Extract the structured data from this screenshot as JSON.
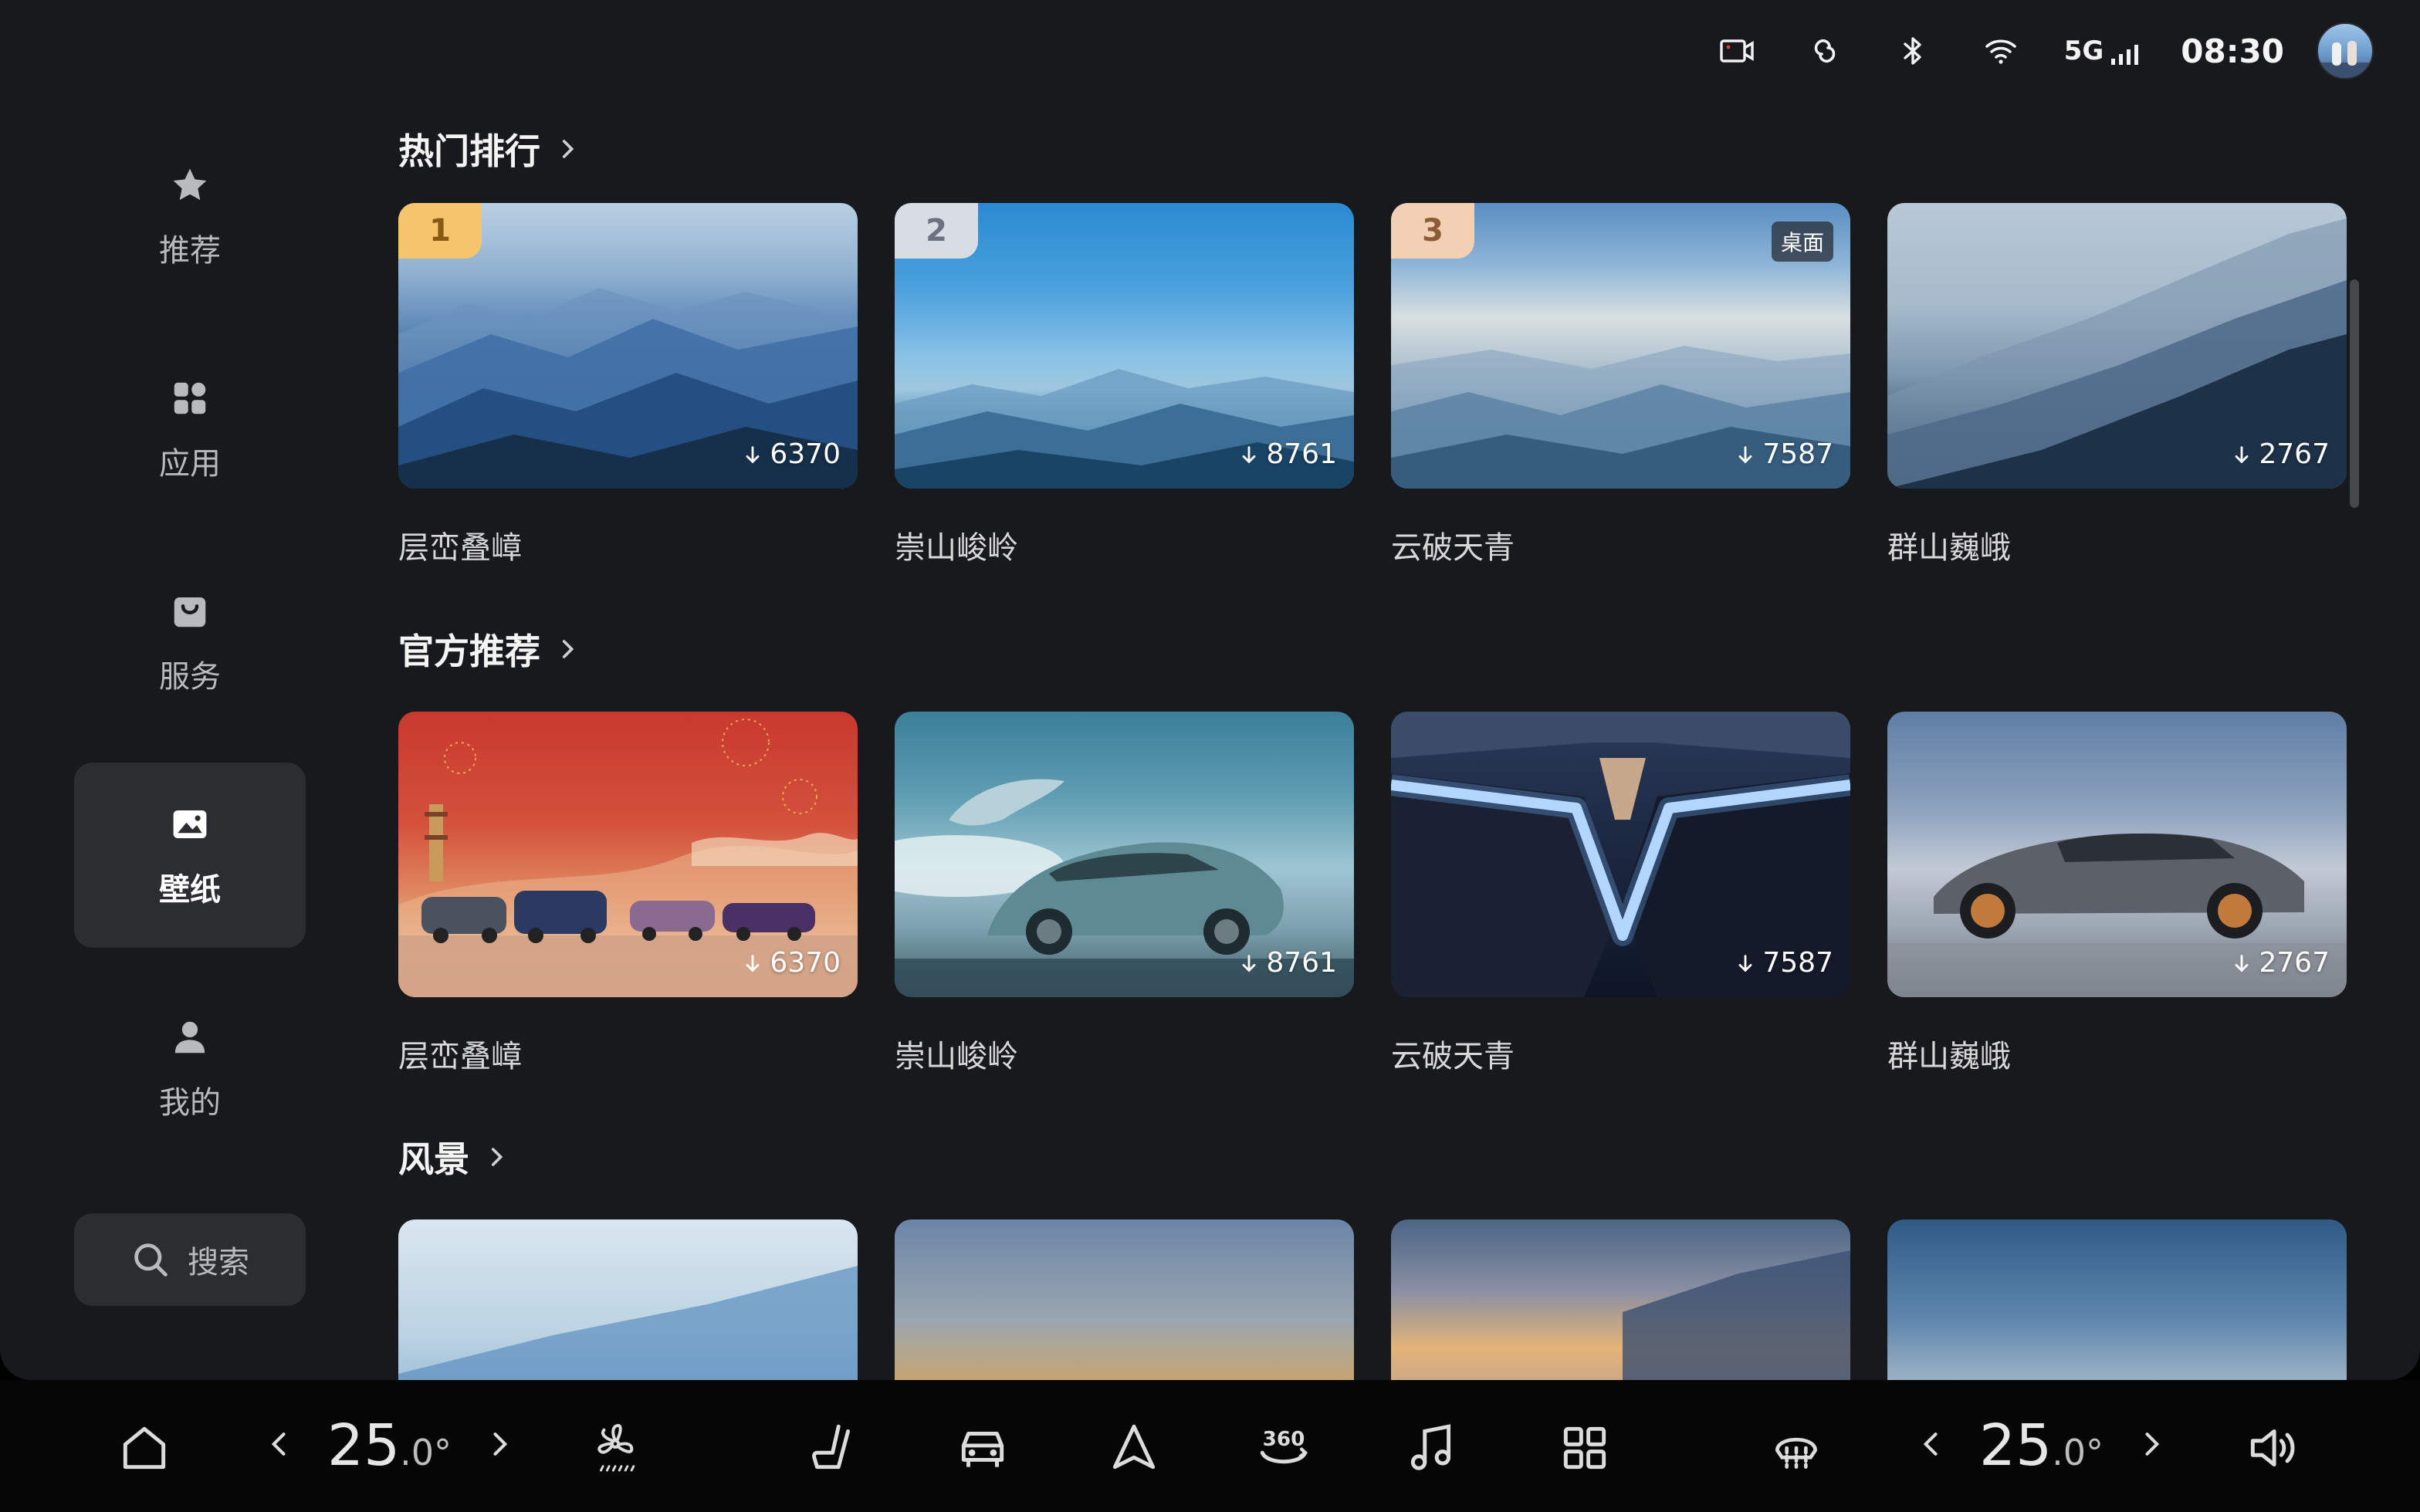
{
  "status_bar": {
    "network": "5G",
    "time": "08:30",
    "icons": [
      "dashcam-icon",
      "link-icon",
      "bluetooth-icon",
      "wifi-icon",
      "signal-icon",
      "avatar"
    ]
  },
  "sidebar": {
    "items": [
      {
        "label": "推荐",
        "icon": "star-icon",
        "active": false
      },
      {
        "label": "应用",
        "icon": "apps-icon",
        "active": false
      },
      {
        "label": "服务",
        "icon": "bag-icon",
        "active": false
      },
      {
        "label": "壁纸",
        "icon": "image-icon",
        "active": true
      },
      {
        "label": "我的",
        "icon": "person-icon",
        "active": false
      }
    ],
    "search_label": "搜索"
  },
  "sections": [
    {
      "title": "热门排行",
      "cards": [
        {
          "title": "层峦叠嶂",
          "downloads": "6370",
          "rank": "1"
        },
        {
          "title": "崇山峻岭",
          "downloads": "8761",
          "rank": "2"
        },
        {
          "title": "云破天青",
          "downloads": "7587",
          "rank": "3",
          "badge": "桌面"
        },
        {
          "title": "群山巍峨",
          "downloads": "2767"
        }
      ]
    },
    {
      "title": "官方推荐",
      "cards": [
        {
          "title": "层峦叠嶂",
          "downloads": "6370"
        },
        {
          "title": "崇山峻岭",
          "downloads": "8761"
        },
        {
          "title": "云破天青",
          "downloads": "7587"
        },
        {
          "title": "群山巍峨",
          "downloads": "2767"
        }
      ]
    },
    {
      "title": "风景",
      "cards": []
    }
  ],
  "dock": {
    "left_temp": {
      "int": "25",
      "dec": ".0°"
    },
    "right_temp": {
      "int": "25",
      "dec": ".0°"
    },
    "icons": [
      "home-icon",
      "fan-icon",
      "seat-icon",
      "car-icon",
      "navigation-icon",
      "360-camera-icon",
      "music-icon",
      "app-grid-icon",
      "rear-defrost-icon",
      "volume-icon"
    ],
    "cam_label": "360"
  }
}
